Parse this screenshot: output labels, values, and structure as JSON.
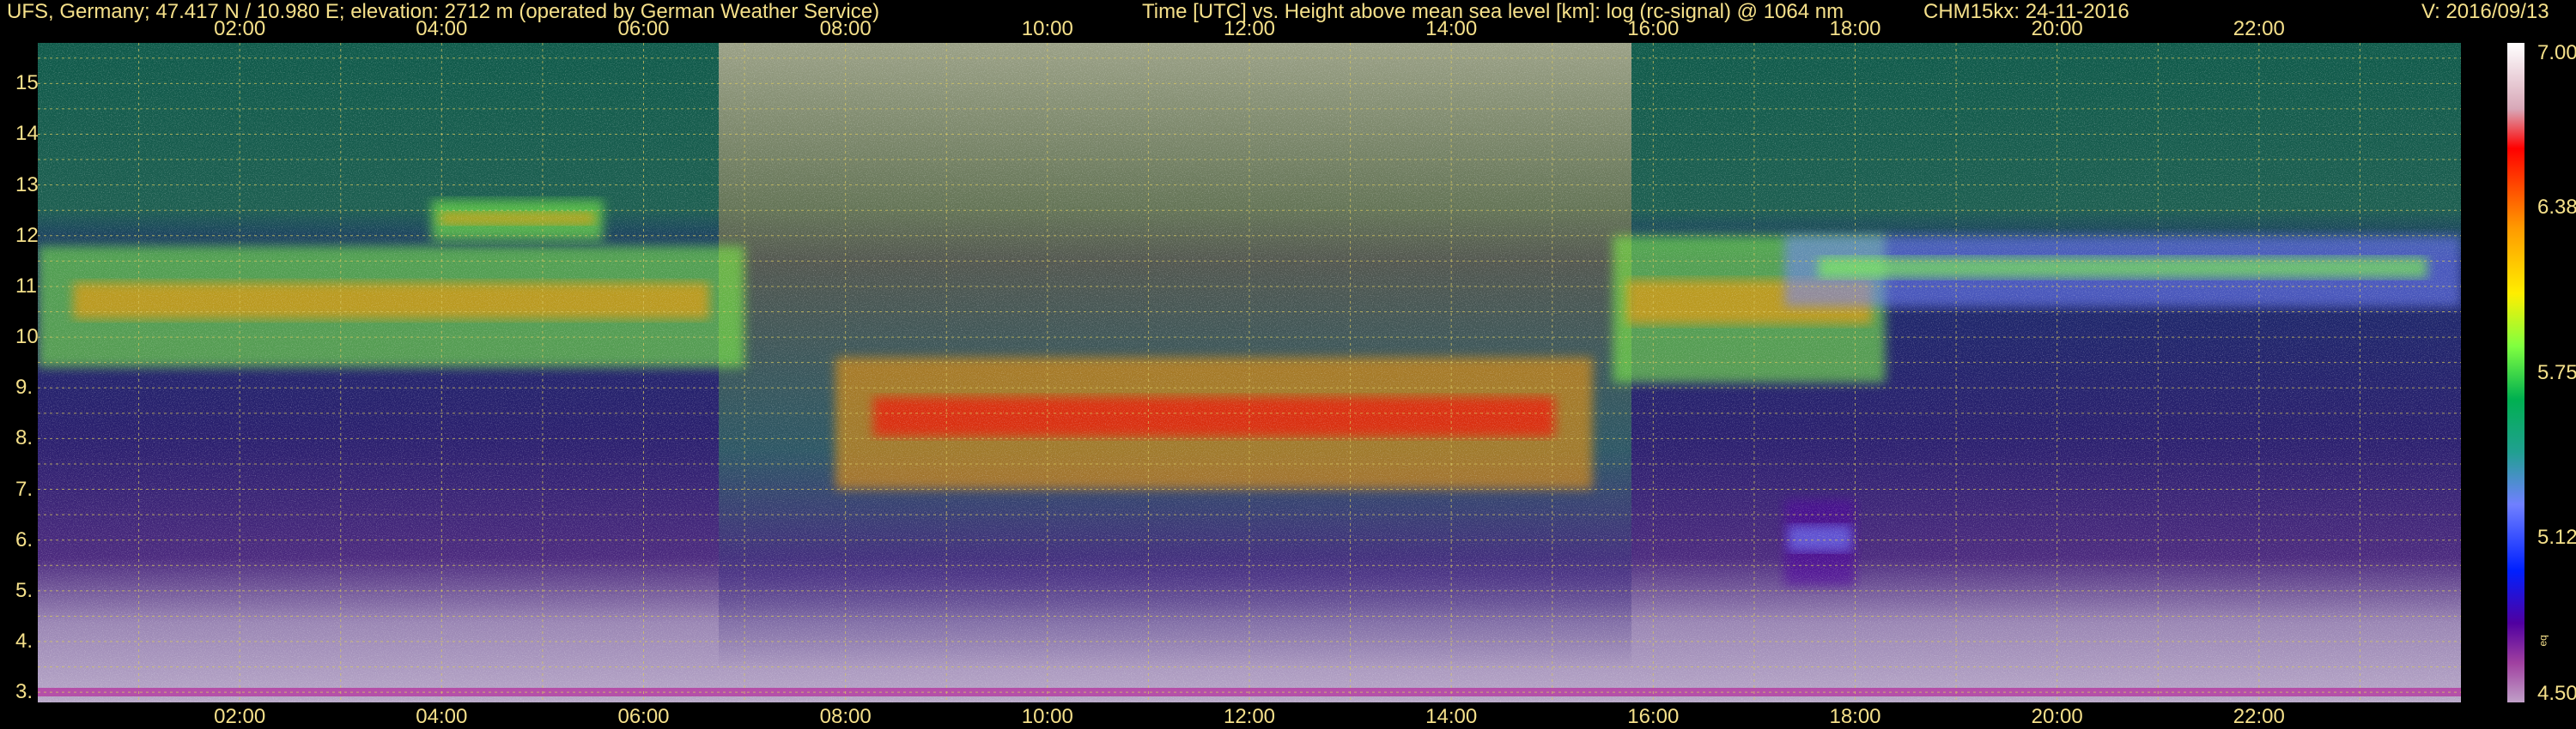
{
  "header": {
    "station": "UFS, Germany; 47.417 N / 10.980 E; elevation: 2712 m  (operated by German Weather Service)",
    "axes_title": "Time [UTC] vs. Height above mean sea level [km]: log (rc-signal) @ 1064 nm",
    "instrument": "CHM15kx: 24-11-2016",
    "version": "V: 2016/09/13"
  },
  "colorbar": {
    "ticks": [
      "7.00",
      "6.38",
      "5.75",
      "5.12",
      "4.50"
    ],
    "sublabel": "eq"
  },
  "chart_data": {
    "type": "heatmap",
    "title": "Time [UTC] vs. Height above mean sea level [km]: log (rc-signal) @ 1064 nm",
    "xlabel": "Time [UTC]",
    "ylabel": "Height above mean sea level [km]",
    "xlim": [
      0,
      24
    ],
    "ylim": [
      2.8,
      15.8
    ],
    "x_ticks": [
      "02:00",
      "04:00",
      "06:00",
      "08:00",
      "10:00",
      "12:00",
      "14:00",
      "16:00",
      "18:00",
      "20:00",
      "22:00"
    ],
    "y_ticks": [
      "3.",
      "4.",
      "5.",
      "6.",
      "7.",
      "8.",
      "9.",
      "10.",
      "11.",
      "12.",
      "13.",
      "14.",
      "15."
    ],
    "colorbar_range": [
      4.5,
      7.0
    ],
    "grid": true,
    "layers": [
      {
        "t_start": 0.0,
        "t_end": 7.0,
        "h_bottom": 9.4,
        "h_top": 11.8,
        "signal": 6.3
      },
      {
        "t_start": 3.9,
        "t_end": 5.6,
        "h_bottom": 11.9,
        "h_top": 12.7,
        "signal": 6.4
      },
      {
        "t_start": 7.9,
        "t_end": 15.4,
        "h_bottom": 7.0,
        "h_top": 9.6,
        "signal": 6.9
      },
      {
        "t_start": 15.6,
        "t_end": 18.3,
        "h_bottom": 9.1,
        "h_top": 12.0,
        "signal": 6.4
      },
      {
        "t_start": 17.3,
        "t_end": 24.0,
        "h_bottom": 10.6,
        "h_top": 12.0,
        "signal": 6.0
      },
      {
        "t_start": 17.3,
        "t_end": 18.0,
        "h_bottom": 5.1,
        "h_top": 6.8,
        "signal": 5.6
      }
    ]
  }
}
